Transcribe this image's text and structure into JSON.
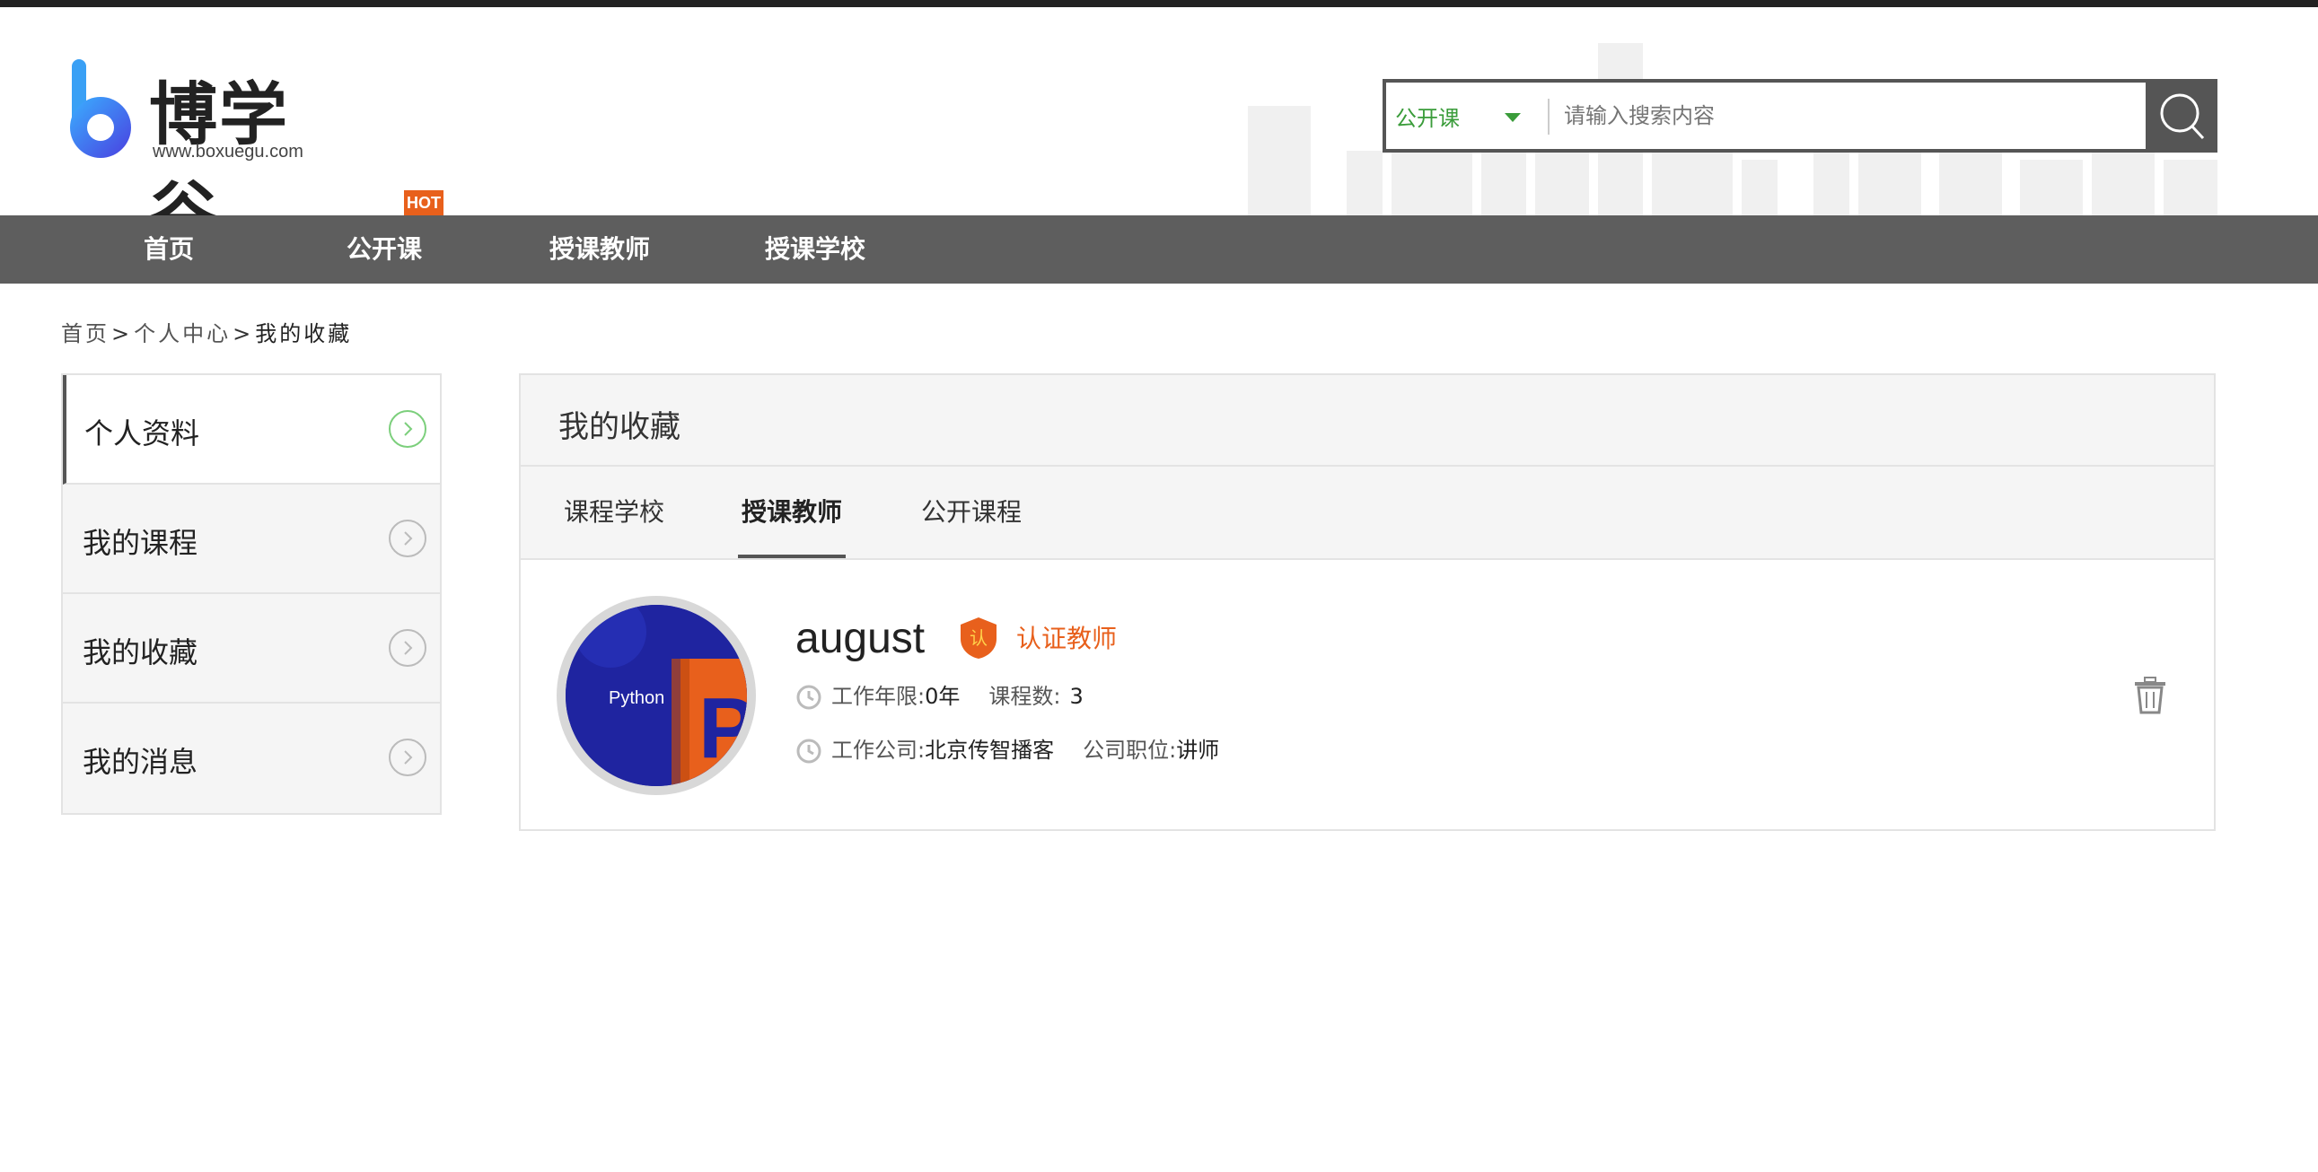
{
  "brand": {
    "name": "博学谷",
    "url_text": "www.boxuegu.com",
    "accent_color": "#3a9c3a",
    "highlight_color": "#e8601c"
  },
  "search": {
    "category": "公开课",
    "placeholder": "请输入搜索内容",
    "icon": "search-icon"
  },
  "nav": {
    "items": [
      {
        "label": "首页"
      },
      {
        "label": "公开课",
        "badge": "HOT"
      },
      {
        "label": "授课教师"
      },
      {
        "label": "授课学校"
      }
    ]
  },
  "breadcrumb": {
    "items": [
      "首页",
      "个人中心",
      "我的收藏"
    ],
    "separator": ">"
  },
  "sidebar": {
    "items": [
      {
        "label": "个人资料",
        "active": true
      },
      {
        "label": "我的课程"
      },
      {
        "label": "我的收藏"
      },
      {
        "label": "我的消息"
      }
    ]
  },
  "main": {
    "title": "我的收藏",
    "tabs": [
      {
        "label": "课程学校"
      },
      {
        "label": "授课教师",
        "active": true
      },
      {
        "label": "公开课程"
      }
    ],
    "teacher": {
      "name": "august",
      "cert_label": "认证教师",
      "cert_badge": "认",
      "avatar_text": "Python",
      "avatar_letter": "P",
      "work_years_label": "工作年限:",
      "work_years_value": "0年",
      "course_count_label": "课程数:",
      "course_count_value": "3",
      "company_label": "工作公司:",
      "company_value": "北京传智播客",
      "position_label": "公司职位:",
      "position_value": "讲师"
    }
  }
}
